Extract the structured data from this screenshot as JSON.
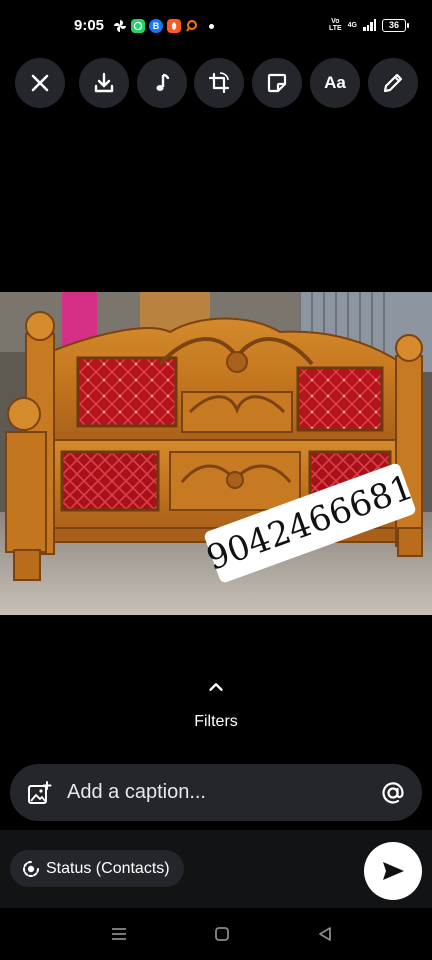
{
  "status_bar": {
    "time": "9:05",
    "network_top": "Vo",
    "network_bottom": "LTE",
    "data_type": "4G",
    "battery": "36"
  },
  "status_apps": [
    {
      "icon": "pinwheel-icon",
      "color": "#000000"
    },
    {
      "icon": "whatsapp-icon",
      "color": "#25D366"
    },
    {
      "icon": "b-icon",
      "color": "#1877F2"
    },
    {
      "icon": "orange-app-icon",
      "color": "#ff5a1f"
    },
    {
      "icon": "search-app-icon",
      "color": "#ff7a00"
    }
  ],
  "toolbar": {
    "text_tool_label": "Aa"
  },
  "image": {
    "watermark_phone": "9042466681"
  },
  "filters": {
    "label": "Filters"
  },
  "caption": {
    "placeholder": "Add a caption..."
  },
  "audience": {
    "label": "Status (Contacts)"
  },
  "colors": {
    "background": "#000000",
    "button_bg": "#24262b",
    "bottom_panel": "#111315",
    "send_button": "#ffffff"
  }
}
